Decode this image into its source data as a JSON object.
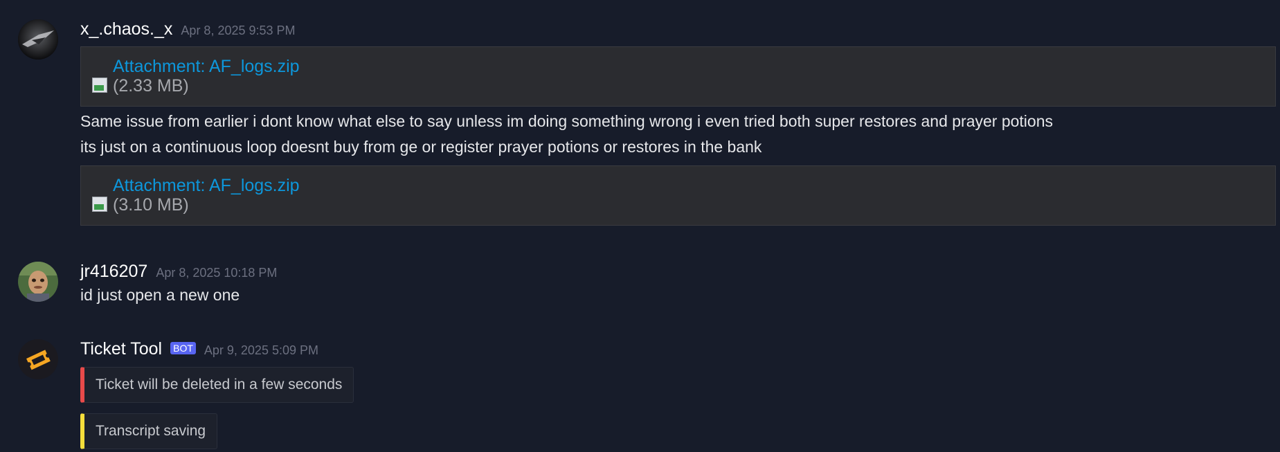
{
  "messages": [
    {
      "username": "x_.chaos._x",
      "timestamp": "Apr 8, 2025 9:53 PM",
      "attachments_before": [
        {
          "label": "Attachment: AF_logs.zip",
          "size": "(2.33 MB)"
        }
      ],
      "lines": [
        "Same issue from earlier i dont know what else to say unless im doing something wrong i even tried both super restores and prayer potions",
        "its just on a continuous loop doesnt buy from ge or register prayer potions or restores in the bank"
      ],
      "attachments_after": [
        {
          "label": "Attachment: AF_logs.zip",
          "size": "(3.10 MB)"
        }
      ]
    },
    {
      "username": "jr416207",
      "timestamp": "Apr 8, 2025 10:18 PM",
      "lines": [
        "id just open a new one"
      ]
    },
    {
      "username": "Ticket Tool",
      "badge": "BOT",
      "timestamp": "Apr 9, 2025 5:09 PM",
      "embeds": [
        {
          "text": "Ticket will be deleted in a few seconds",
          "color": "#e84a4a"
        },
        {
          "text": "Transcript saving",
          "color": "#f5de3b"
        }
      ]
    }
  ]
}
